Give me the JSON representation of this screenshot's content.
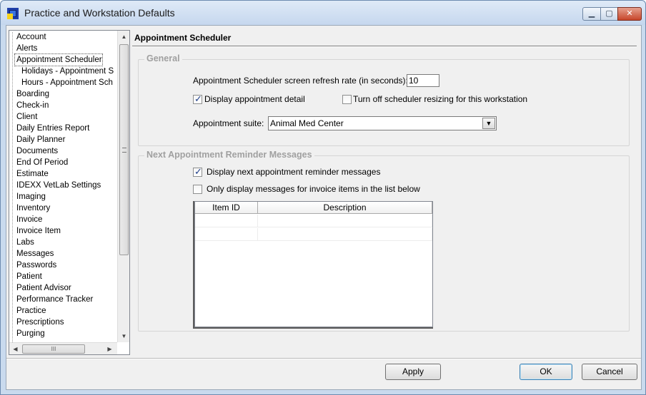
{
  "window": {
    "title": "Practice and Workstation Defaults",
    "controls": {
      "minimize": "▁",
      "maximize": "▢",
      "close": "✕"
    }
  },
  "tree": {
    "items": [
      "Account",
      "Alerts",
      "Appointment Scheduler",
      "Holidays - Appointment S",
      "Hours - Appointment Sch",
      "Boarding",
      "Check-in",
      "Client",
      "Daily Entries Report",
      "Daily Planner",
      "Documents",
      "End Of Period",
      "Estimate",
      "IDEXX VetLab Settings",
      "Imaging",
      "Inventory",
      "Invoice",
      "Invoice Item",
      "Labs",
      "Messages",
      "Passwords",
      "Patient",
      "Patient Advisor",
      "Performance Tracker",
      "Practice",
      "Prescriptions",
      "Purging"
    ],
    "selected": "Appointment Scheduler",
    "scroll_up": "▲",
    "scroll_down": "▼",
    "scroll_left": "◀",
    "scroll_right": "▶",
    "hthumb_grip": "III"
  },
  "panel": {
    "title": "Appointment Scheduler",
    "general": {
      "legend": "General",
      "refresh_label": "Appointment Scheduler screen refresh rate (in seconds):",
      "refresh_value": "10",
      "display_detail_label": "Display appointment detail",
      "display_detail_checked": true,
      "turn_off_resizing_label": "Turn off scheduler resizing for this workstation",
      "turn_off_resizing_checked": false,
      "suite_label": "Appointment suite:",
      "suite_value": "Animal Med Center",
      "suite_dropdown": "▼"
    },
    "reminders": {
      "legend": "Next Appointment Reminder Messages",
      "display_next_label": "Display next appointment reminder messages",
      "display_next_checked": true,
      "only_invoice_label": "Only display messages for invoice items in the list below",
      "only_invoice_checked": false,
      "columns": [
        "Item ID",
        "Description"
      ],
      "rows": [
        [
          "",
          ""
        ],
        [
          "",
          ""
        ]
      ]
    }
  },
  "footer": {
    "apply": "Apply",
    "ok": "OK",
    "cancel": "Cancel"
  }
}
